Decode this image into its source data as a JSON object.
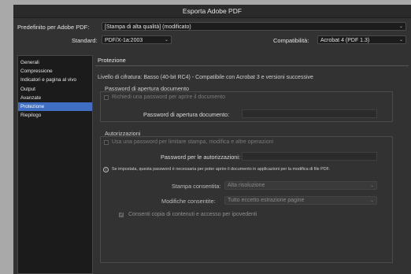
{
  "window": {
    "title": "Esporta Adobe PDF"
  },
  "preset": {
    "label": "Predefinito per Adobe PDF:",
    "value": "[Stampa di alta qualità] (modificato)"
  },
  "standard": {
    "label": "Standard:",
    "value": "PDF/X-1a:2003"
  },
  "compat": {
    "label": "Compatibilità:",
    "value": "Acrobat 4 (PDF 1.3)"
  },
  "sidebar": {
    "items": [
      {
        "label": "Generali"
      },
      {
        "label": "Compressione"
      },
      {
        "label": "Indicatori e pagina al vivo"
      },
      {
        "label": "Output"
      },
      {
        "label": "Avanzate"
      },
      {
        "label": "Protezione"
      },
      {
        "label": "Riepilogo"
      }
    ]
  },
  "section": {
    "title": "Protezione"
  },
  "encryption": "Livello di cifratura: Basso (40-bit RC4) - Compatibile con Acrobat 3 e versioni successive",
  "open_pw": {
    "group_title": "Password di apertura documento",
    "checkbox_label": "Richiedi una password per aprire il documento",
    "field_label": "Password di apertura documento:"
  },
  "perms": {
    "group_title": "Autorizzazioni",
    "checkbox_label": "Usa una password per limitare stampa, modifica e altre operazioni",
    "field_label": "Password per le autorizzazioni:",
    "info": "Se impostata, questa password è necessaria per poter aprire il documento in applicazioni per la modifica di file PDF.",
    "print_label": "Stampa consentita:",
    "print_value": "Alta risoluzione",
    "changes_label": "Modifiche consentite:",
    "changes_value": "Tutto eccetto estrazione pagine",
    "copy_label": "Consenti copia di contenuti e accesso per ipovedenti"
  },
  "icons": {
    "chevron": "chevron-down-icon",
    "info": "info-icon",
    "check": "checkmark-icon"
  }
}
